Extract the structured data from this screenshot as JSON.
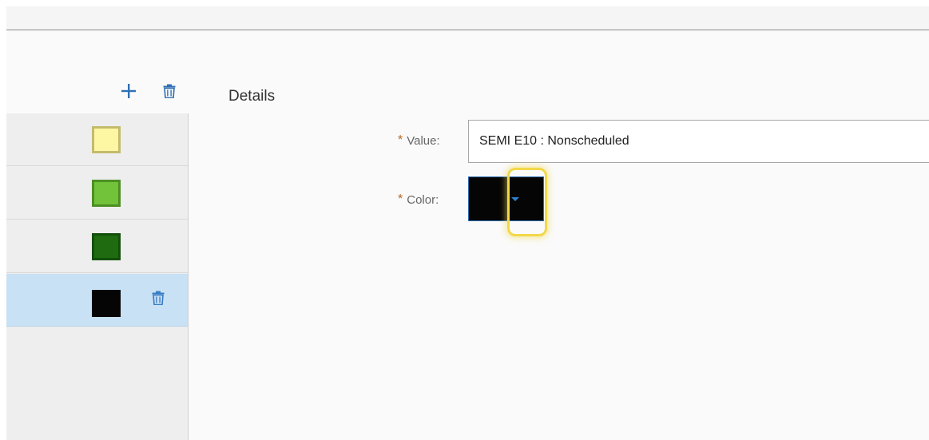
{
  "toolbar": {
    "add_icon": "plus-icon",
    "delete_icon": "trash-icon"
  },
  "list": {
    "items": [
      {
        "swatch_color": "#fdf7a4",
        "swatch_border": "#c4bb6c"
      },
      {
        "swatch_color": "#72c23a",
        "swatch_border": "#4d8f24"
      },
      {
        "swatch_color": "#1e6b10",
        "swatch_border": "#14500a"
      },
      {
        "swatch_color": "#050505",
        "swatch_border": "#050505",
        "selected": true,
        "row_delete_icon": "trash-icon"
      }
    ]
  },
  "details": {
    "title": "Details",
    "value_field": {
      "required_mark": "*",
      "label": "Value:",
      "value": "SEMI E10 : Nonscheduled"
    },
    "color_field": {
      "required_mark": "*",
      "label": "Color:",
      "value": "#050505",
      "dropdown_icon": "caret-down-icon"
    }
  },
  "colors": {
    "accent": "#2f7fd0",
    "selected_row": "#c8e1f4",
    "highlight": "#f2d84a"
  }
}
